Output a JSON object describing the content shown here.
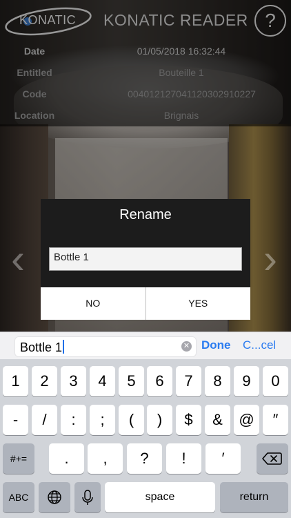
{
  "header": {
    "logo_text": "KONATIC",
    "title": "KONATIC READER",
    "help_label": "?"
  },
  "info": {
    "rows": [
      {
        "label": "Date",
        "value": "01/05/2018 16:32:44"
      },
      {
        "label": "Entitled",
        "value": "Bouteille 1"
      },
      {
        "label": "Code",
        "value": "0040121270411203029102​27"
      },
      {
        "label": "Location",
        "value": "Brignais"
      }
    ]
  },
  "dialog": {
    "title": "Rename",
    "input_value": "Bottle 1",
    "no_label": "NO",
    "yes_label": "YES"
  },
  "accessory": {
    "field_value": "Bottle 1",
    "done_label": "Done",
    "cancel_label": "C...cel"
  },
  "keyboard": {
    "row1": [
      "1",
      "2",
      "3",
      "4",
      "5",
      "6",
      "7",
      "8",
      "9",
      "0"
    ],
    "row2": [
      "-",
      "/",
      ":",
      ";",
      "(",
      ")",
      "$",
      "&",
      "@",
      "″"
    ],
    "row3_left": "#+=",
    "row3": [
      ".",
      ",",
      "?",
      "!",
      "′"
    ],
    "abc_label": "ABC",
    "space_label": "space",
    "return_label": "return"
  },
  "colors": {
    "accent": "#2b7cf0",
    "dialog_bg": "#1c1c1c",
    "keyboard_bg": "#d1d4d9"
  }
}
